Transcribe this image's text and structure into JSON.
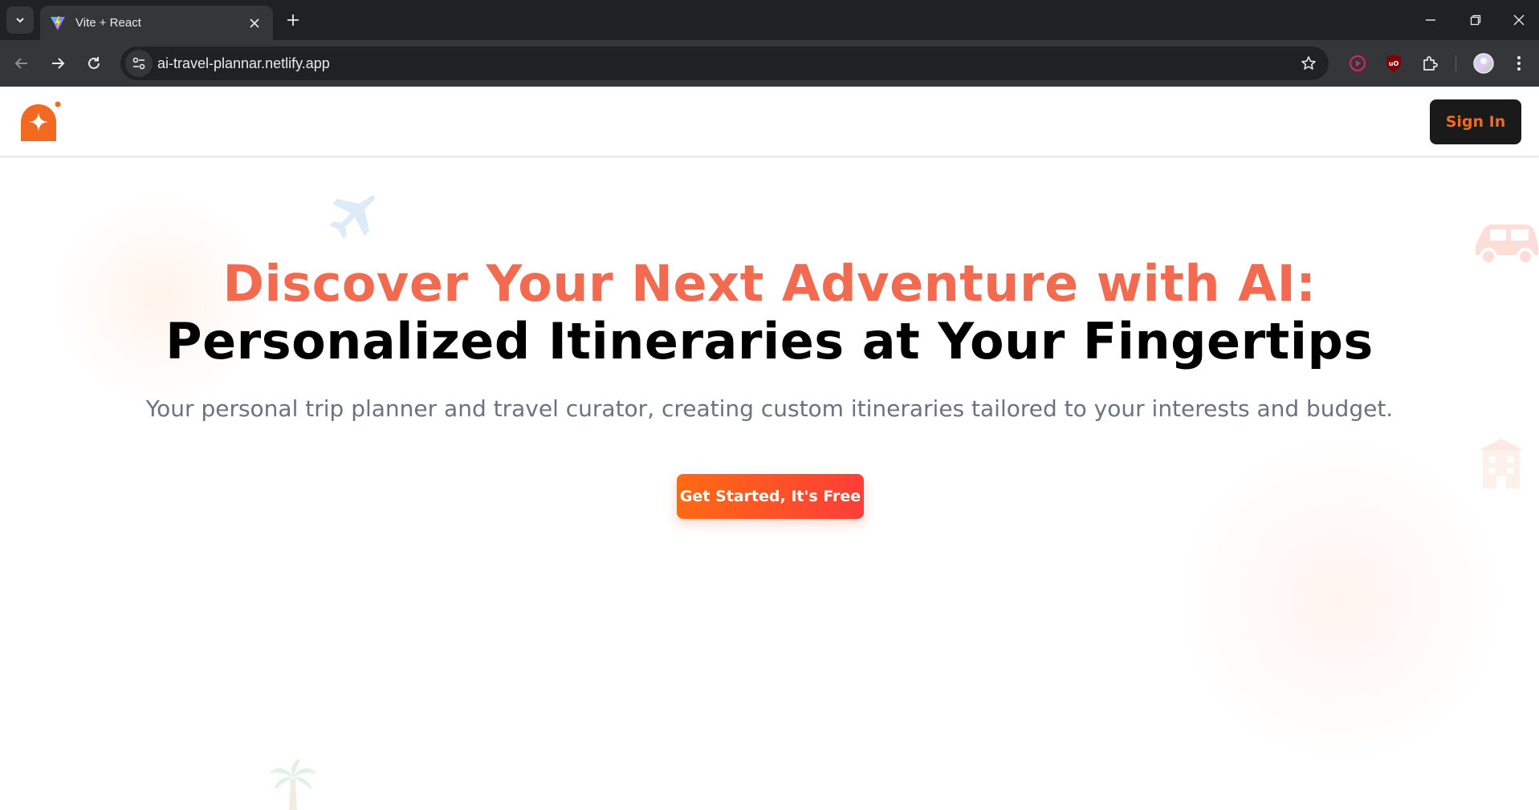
{
  "browser": {
    "tab_title": "Vite + React",
    "url": "ai-travel-plannar.netlify.app"
  },
  "header": {
    "sign_in_label": "Sign In"
  },
  "hero": {
    "title_line1": "Discover Your Next Adventure with AI:",
    "title_line2": "Personalized Itineraries at Your Fingertips",
    "subtitle": "Your personal trip planner and travel curator, creating custom itineraries tailored to your interests and budget.",
    "cta_label": "Get Started, It's Free"
  },
  "colors": {
    "accent": "#f26a4f",
    "brand_orange": "#f26a21",
    "cta_gradient_start": "#ff6a13",
    "cta_gradient_end": "#fe3d39",
    "signin_bg": "#1a1a1a"
  }
}
